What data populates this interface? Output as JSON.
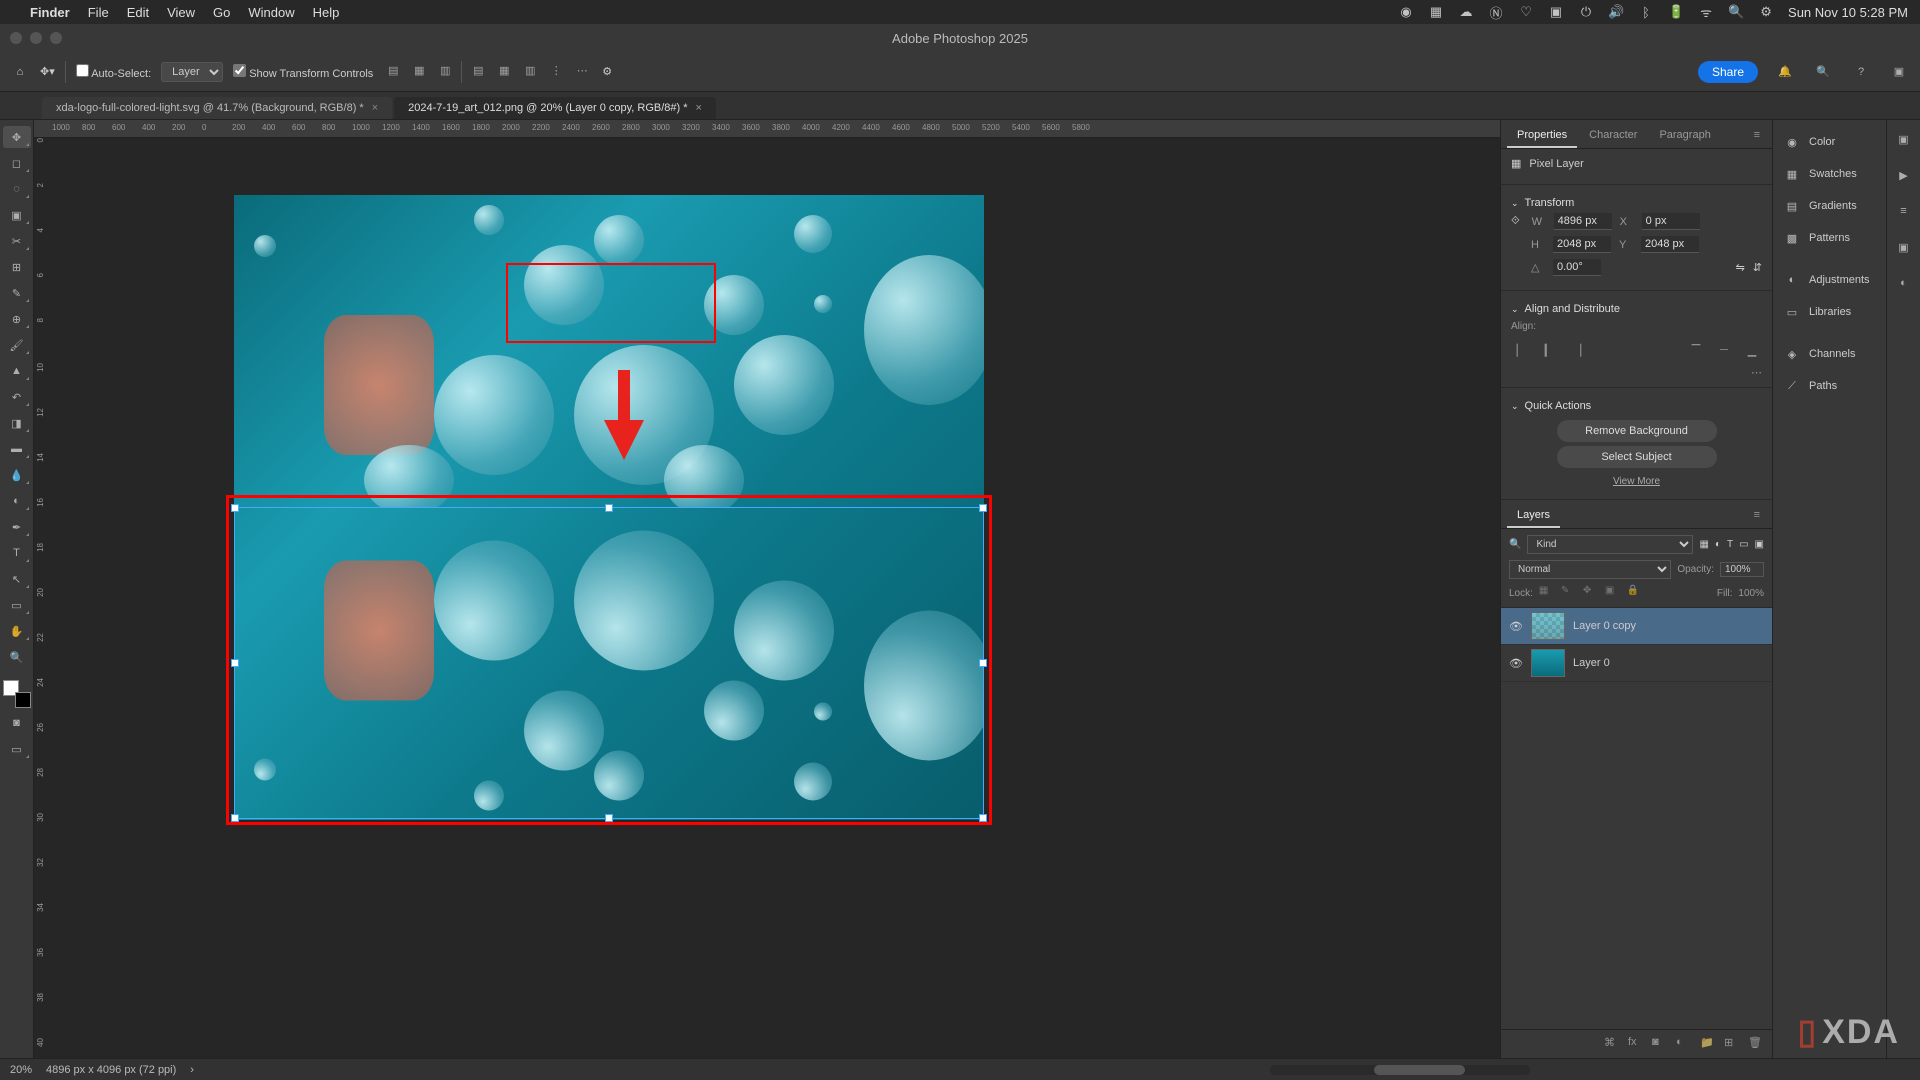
{
  "mac": {
    "app": "Finder",
    "menus": [
      "File",
      "Edit",
      "View",
      "Go",
      "Window",
      "Help"
    ],
    "clock": "Sun Nov 10  5:28 PM"
  },
  "title": "Adobe Photoshop 2025",
  "options": {
    "autoSelect": "Auto-Select:",
    "autoSelectVal": "Layer",
    "showTransform": "Show Transform Controls",
    "share": "Share"
  },
  "tabs": [
    {
      "label": "xda-logo-full-colored-light.svg @ 41.7% (Background, RGB/8) *"
    },
    {
      "label": "2024-7-19_art_012.png @ 20% (Layer 0 copy, RGB/8#) *"
    }
  ],
  "rulerH": [
    "1000",
    "800",
    "600",
    "400",
    "200",
    "0",
    "200",
    "400",
    "600",
    "800",
    "1000",
    "1200",
    "1400",
    "1600",
    "1800",
    "2000",
    "2200",
    "2400",
    "2600",
    "2800",
    "3000",
    "3200",
    "3400",
    "3600",
    "3800",
    "4000",
    "4200",
    "4400",
    "4600",
    "4800",
    "5000",
    "5200",
    "5400",
    "5600",
    "5800"
  ],
  "rulerV": [
    "0",
    "2",
    "4",
    "6",
    "8",
    "10",
    "12",
    "14",
    "16",
    "18",
    "20",
    "22",
    "24",
    "26",
    "28",
    "30",
    "32",
    "34",
    "36",
    "38",
    "40"
  ],
  "properties": {
    "tab1": "Properties",
    "tab2": "Character",
    "tab3": "Paragraph",
    "layerType": "Pixel Layer",
    "transform": "Transform",
    "W": "4896 px",
    "H": "2048 px",
    "X": "0 px",
    "Y": "2048 px",
    "angle": "0.00°",
    "align": "Align and Distribute",
    "alignLbl": "Align:",
    "quick": "Quick Actions",
    "qa1": "Remove Background",
    "qa2": "Select Subject",
    "qa3": "View More"
  },
  "layers": {
    "title": "Layers",
    "kind": "Kind",
    "blend": "Normal",
    "opacity": "Opacity:",
    "opVal": "100%",
    "lock": "Lock:",
    "fill": "Fill:",
    "fillVal": "100%",
    "items": [
      {
        "name": "Layer 0 copy"
      },
      {
        "name": "Layer 0"
      }
    ]
  },
  "sidePanels": [
    "Color",
    "Swatches",
    "Gradients",
    "Patterns",
    "Adjustments",
    "Libraries",
    "Channels",
    "Paths"
  ],
  "status": {
    "zoom": "20%",
    "dims": "4896 px x 4096 px (72 ppi)"
  },
  "watermark": "XDA"
}
